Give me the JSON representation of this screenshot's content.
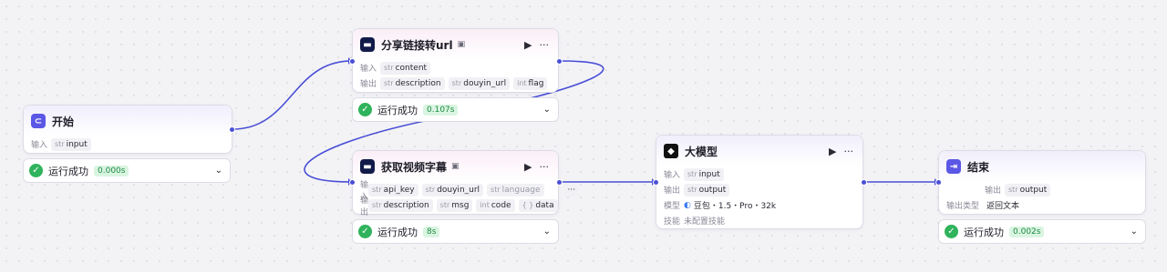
{
  "colors": {
    "edge": "#4a4fd6",
    "success": "#2fb35c",
    "accent": "#5b57e6"
  },
  "start_node": {
    "title": "开始",
    "icon": "start-icon",
    "input_label": "输入",
    "inputs": [
      {
        "type": "str",
        "name": "input"
      }
    ],
    "status": {
      "text": "运行成功",
      "time": "0.000s"
    }
  },
  "share_node": {
    "title": "分享链接转url",
    "icon": "plugin-icon",
    "input_label": "输入",
    "inputs": [
      {
        "type": "str",
        "name": "content"
      }
    ],
    "output_label": "输出",
    "outputs": [
      {
        "type": "str",
        "name": "description"
      },
      {
        "type": "str",
        "name": "douyin_url"
      },
      {
        "type": "int",
        "name": "flag"
      }
    ],
    "status": {
      "text": "运行成功",
      "time": "0.107s"
    }
  },
  "subtitle_node": {
    "title": "获取视频字幕",
    "icon": "plugin-icon",
    "input_label": "输入",
    "inputs": [
      {
        "type": "str",
        "name": "api_key"
      },
      {
        "type": "str",
        "name": "douyin_url"
      },
      {
        "type": "str",
        "name": "language"
      }
    ],
    "more": "···",
    "output_label": "输出",
    "outputs": [
      {
        "type": "str",
        "name": "description"
      },
      {
        "type": "str",
        "name": "msg"
      },
      {
        "type": "int",
        "name": "code"
      },
      {
        "type": "{ }",
        "name": "data"
      }
    ],
    "status": {
      "text": "运行成功",
      "time": "8s"
    }
  },
  "llm_node": {
    "title": "大模型",
    "icon": "llm-icon",
    "input_label": "输入",
    "inputs": [
      {
        "type": "str",
        "name": "input"
      }
    ],
    "output_label": "输出",
    "outputs": [
      {
        "type": "str",
        "name": "output"
      }
    ],
    "model_label": "模型",
    "model_value": "豆包・1.5・Pro・32k",
    "skill_label": "技能",
    "skill_value": "未配置技能"
  },
  "end_node": {
    "title": "结束",
    "icon": "end-icon",
    "output_label": "输出",
    "outputs": [
      {
        "type": "str",
        "name": "output"
      }
    ],
    "output_type_label": "输出类型",
    "output_type_value": "返回文本",
    "status": {
      "text": "运行成功",
      "time": "0.002s"
    }
  }
}
